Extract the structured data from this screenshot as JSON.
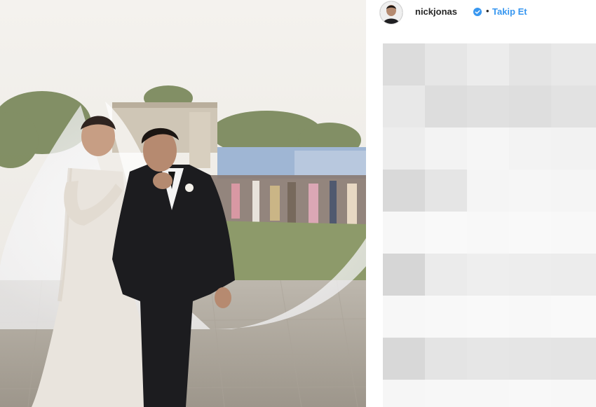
{
  "post": {
    "image_alt": "wedding-photo"
  },
  "header": {
    "username": "nickjonas",
    "separator": "•",
    "follow_label": "Takip Et"
  },
  "colors": {
    "follow_blue": "#3897f0",
    "verified_blue": "#3897f0",
    "username_text": "#262626"
  },
  "icons": {
    "verified": "verified-badge-icon"
  },
  "comments": {
    "blurred": true,
    "shades": [
      "#dcdcdc",
      "#e6e6e6",
      "#ececec",
      "#e4e4e4",
      "#e8e8e8",
      "#e8e8e8",
      "#dddddd",
      "#e0e0e0",
      "#dedede",
      "#e2e2e2",
      "#ededed",
      "#f3f3f3",
      "#f6f6f6",
      "#f3f3f3",
      "#f2f2f2",
      "#d9d9d9",
      "#e5e5e5",
      "#f5f5f5",
      "#f6f6f6",
      "#f5f5f5",
      "#f7f7f7",
      "#f9f9f9",
      "#f8f8f8",
      "#f9f9f9",
      "#f8f8f8",
      "#d6d6d6",
      "#ebebeb",
      "#eeeeee",
      "#ededed",
      "#ececec",
      "#f7f7f7",
      "#f8f8f8",
      "#f9f9f9",
      "#f8f8f8",
      "#f9f9f9",
      "#d8d8d8",
      "#e4e4e4",
      "#e6e6e6",
      "#e5e5e5",
      "#e4e4e4",
      "#f6f6f6",
      "#f7f7f7",
      "#f7f7f7",
      "#f8f8f8",
      "#f7f7f7"
    ]
  }
}
